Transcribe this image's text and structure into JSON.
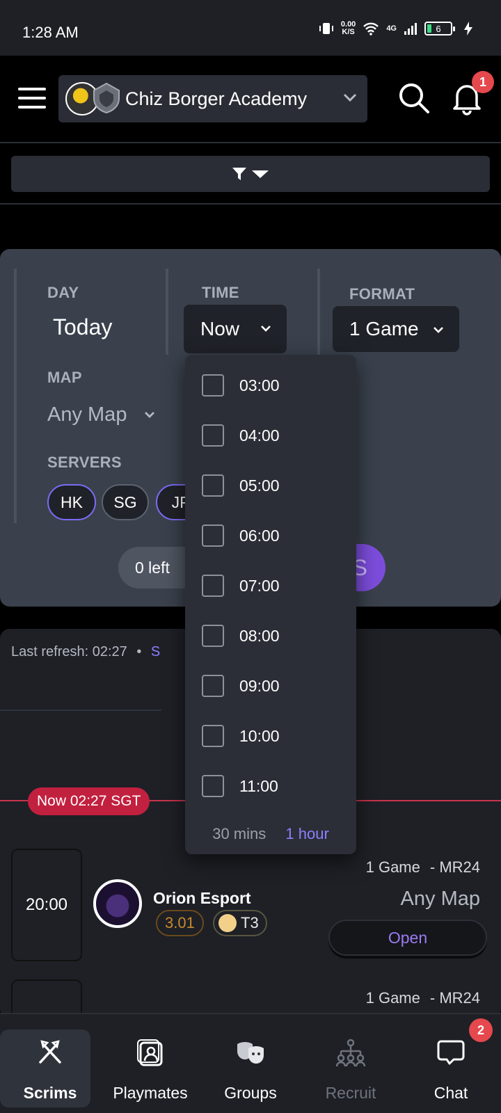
{
  "status_bar": {
    "time": "1:28 AM",
    "net_speed": "0.00",
    "net_unit": "K/S",
    "network": "4G",
    "battery": "6"
  },
  "header": {
    "team_name": "Chiz Borger Academy",
    "notification_count": "1"
  },
  "form": {
    "day_label": "DAY",
    "day_value": "Today",
    "time_label": "TIME",
    "time_value": "Now",
    "format_label": "FORMAT",
    "format_value": "1 Game",
    "map_label": "MAP",
    "map_value": "Any Map",
    "servers_label": "SERVERS",
    "servers": [
      "HK",
      "SG",
      "JP"
    ],
    "left_text": "0 left",
    "post_text": "S"
  },
  "time_dropdown": {
    "options": [
      "03:00",
      "04:00",
      "05:00",
      "06:00",
      "07:00",
      "08:00",
      "09:00",
      "10:00",
      "11:00"
    ],
    "interval_30": "30 mins",
    "interval_60": "1 hour"
  },
  "list": {
    "last_refresh": "Last refresh: 02:27",
    "separator": "•",
    "refresh_link": "S",
    "now_marker": "Now 02:27 SGT",
    "scrims": [
      {
        "time": "20:00",
        "team": "Orion Esport",
        "rating": "3.01",
        "tier": "T3",
        "format": "1 Game",
        "mode": "- MR24",
        "map": "Any Map",
        "action": "Open"
      },
      {
        "time": "",
        "team": "",
        "rating": "",
        "tier": "",
        "format": "1 Game",
        "mode": "- MR24",
        "map": "",
        "action": ""
      }
    ]
  },
  "bottom_nav": {
    "items": [
      {
        "label": "Scrims",
        "icon": "crossed-axes-icon",
        "active": true
      },
      {
        "label": "Playmates",
        "icon": "profile-card-icon",
        "active": false
      },
      {
        "label": "Groups",
        "icon": "masks-icon",
        "active": false
      },
      {
        "label": "Recruit",
        "icon": "org-chart-icon",
        "active": false
      },
      {
        "label": "Chat",
        "icon": "chat-bubble-icon",
        "active": false
      }
    ],
    "chat_badge": "2"
  },
  "colors": {
    "accent": "#8b80ff",
    "now_red": "#c2203f",
    "badge_red": "#e5484d",
    "card_bg": "#3a414c"
  }
}
